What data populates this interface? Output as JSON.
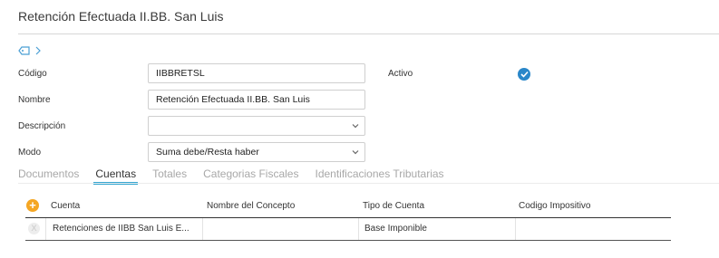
{
  "header": {
    "title": "Retención Efectuada II.BB. San Luis"
  },
  "form": {
    "codigo": {
      "label": "Código",
      "value": "IIBBRETSL"
    },
    "nombre": {
      "label": "Nombre",
      "value": "Retención Efectuada II.BB. San Luis"
    },
    "descripcion": {
      "label": "Descripción",
      "value": ""
    },
    "modo": {
      "label": "Modo",
      "value": "Suma debe/Resta haber"
    },
    "activo": {
      "label": "Activo",
      "checked": true
    }
  },
  "tabs": [
    {
      "label": "Documentos",
      "active": false
    },
    {
      "label": "Cuentas",
      "active": true
    },
    {
      "label": "Totales",
      "active": false
    },
    {
      "label": "Categorias Fiscales",
      "active": false
    },
    {
      "label": "Identificaciones Tributarias",
      "active": false
    }
  ],
  "grid": {
    "columns": [
      "Cuenta",
      "Nombre del Concepto",
      "Tipo de Cuenta",
      "Codigo Impositivo"
    ],
    "rows": [
      {
        "cuenta": "Retenciones de IIBB San Luis E...",
        "nombre_concepto": "",
        "tipo_cuenta": "Base Imponible",
        "codigo_impositivo": ""
      }
    ]
  },
  "colors": {
    "accent": "#33a6d1",
    "check": "#2a87c9",
    "add": "#f5a623"
  },
  "icons": {
    "tag": "tag-icon",
    "expand": "chevron-right-icon",
    "check": "check-circle-icon",
    "dropdown": "chevron-down-icon",
    "add": "plus-circle-icon",
    "delete": "x-circle-icon"
  }
}
